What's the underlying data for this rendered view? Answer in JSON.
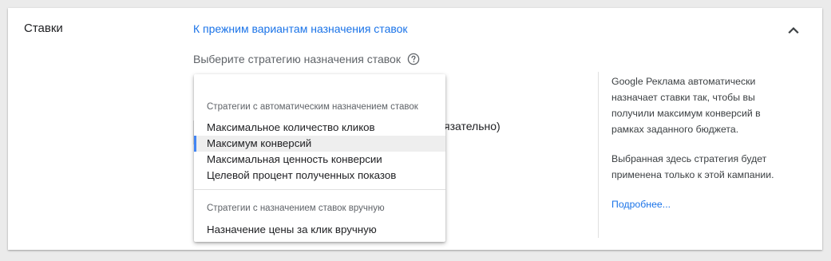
{
  "section": {
    "title": "Ставки",
    "back_link": "К прежним вариантам назначения ставок",
    "strategy_label": "Выберите стратегию назначения ставок",
    "underlay_text": "язательно)"
  },
  "dropdown": {
    "automatic_header": "Стратегии с автоматическим назначением ставок",
    "options": [
      {
        "label": "Максимальное количество кликов"
      },
      {
        "label": "Максимум конверсий"
      },
      {
        "label": "Максимальная ценность конверсии"
      },
      {
        "label": "Целевой процент полученных показов"
      }
    ],
    "selected": "Максимум конверсий",
    "manual_header": "Стратегии с назначением ставок вручную",
    "manual_options": [
      {
        "label": "Назначение цены за клик вручную"
      }
    ]
  },
  "info": {
    "paragraph1": "Google Реклама автоматически назначает ставки так, чтобы вы получили максимум конверсий в рамках заданного бюджета.",
    "paragraph2": "Выбранная здесь стратегия будет применена только к этой кампании.",
    "learn_more": "Подробнее..."
  },
  "colors": {
    "link": "#1a73e8",
    "selected_accent": "#4285f4",
    "selected_bg": "#eeeeee"
  },
  "icons": {
    "collapse": "chevron-up-icon",
    "help": "help-circle-icon"
  }
}
